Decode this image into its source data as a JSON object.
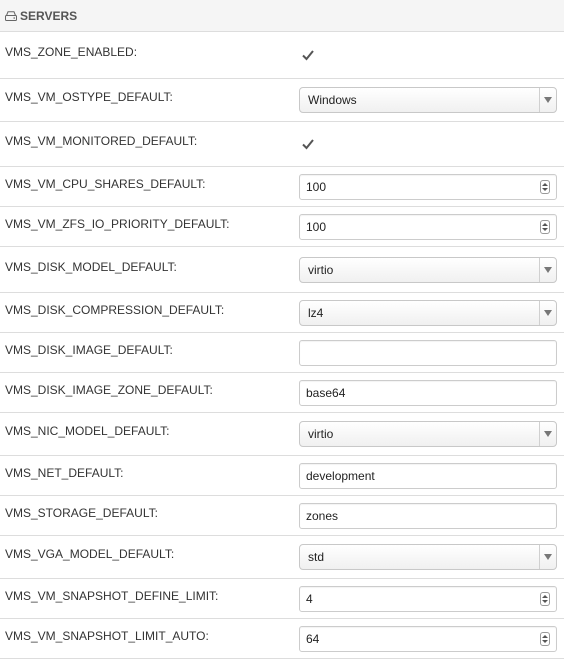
{
  "section": {
    "title": "SERVERS",
    "icon": "hdd-icon"
  },
  "colors": {
    "header_bg": "#f5f5f5",
    "border": "#dddddd",
    "text": "#333333"
  },
  "settings": [
    {
      "key": "VMS_ZONE_ENABLED:",
      "type": "checkbox",
      "checked": true
    },
    {
      "key": "VMS_VM_OSTYPE_DEFAULT:",
      "type": "select",
      "value": "Windows"
    },
    {
      "key": "VMS_VM_MONITORED_DEFAULT:",
      "type": "checkbox",
      "checked": true
    },
    {
      "key": "VMS_VM_CPU_SHARES_DEFAULT:",
      "type": "number",
      "value": "100"
    },
    {
      "key": "VMS_VM_ZFS_IO_PRIORITY_DEFAULT:",
      "type": "number",
      "value": "100"
    },
    {
      "key": "VMS_DISK_MODEL_DEFAULT:",
      "type": "select",
      "value": "virtio"
    },
    {
      "key": "VMS_DISK_COMPRESSION_DEFAULT:",
      "type": "select",
      "value": "lz4"
    },
    {
      "key": "VMS_DISK_IMAGE_DEFAULT:",
      "type": "text",
      "value": ""
    },
    {
      "key": "VMS_DISK_IMAGE_ZONE_DEFAULT:",
      "type": "text",
      "value": "base64"
    },
    {
      "key": "VMS_NIC_MODEL_DEFAULT:",
      "type": "select",
      "value": "virtio"
    },
    {
      "key": "VMS_NET_DEFAULT:",
      "type": "text",
      "value": "development"
    },
    {
      "key": "VMS_STORAGE_DEFAULT:",
      "type": "text",
      "value": "zones"
    },
    {
      "key": "VMS_VGA_MODEL_DEFAULT:",
      "type": "select",
      "value": "std"
    },
    {
      "key": "VMS_VM_SNAPSHOT_DEFINE_LIMIT:",
      "type": "number",
      "value": "4"
    },
    {
      "key": "VMS_VM_SNAPSHOT_LIMIT_AUTO:",
      "type": "number",
      "value": "64"
    }
  ]
}
